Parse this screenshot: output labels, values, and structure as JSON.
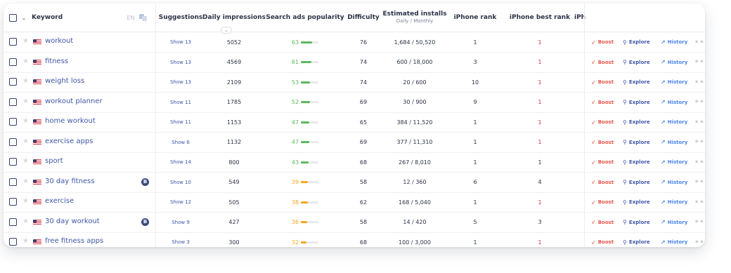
{
  "header": {
    "keyword": "Keyword",
    "lang": "EN",
    "suggestions": "Suggestions",
    "daily_impressions": "Daily impressions",
    "sort_icon": "⌄",
    "search_ads_popularity": "Search ads popularity",
    "difficulty": "Difficulty",
    "estimated_installs": "Estimated installs",
    "estimated_installs_sub": "Daily / Monthly",
    "iphone_rank": "iPhone rank",
    "iphone_best_rank": "iPhone best rank",
    "truncated_col": "iPh"
  },
  "actions": {
    "boost": "Boost",
    "explore": "Explore",
    "history": "History",
    "more": "•••"
  },
  "icons": {
    "boost": "rocket-icon",
    "explore": "search-icon",
    "history": "chart-icon",
    "flag": "us-flag-icon",
    "star": "star-icon",
    "translate": "translate-icon"
  },
  "colors": {
    "green": "#5cb85c",
    "orange": "#f5a623",
    "red": "#c4384a",
    "link": "#3f57a8"
  },
  "rows": [
    {
      "keyword": "workout",
      "badge": "",
      "suggestions": "Show 13",
      "impressions": "5052",
      "popularity": "63",
      "pop_color": "green",
      "difficulty": "76",
      "installs": "1,684 / 50,520",
      "rank": "1",
      "best_rank": "1",
      "best_red": true
    },
    {
      "keyword": "fitness",
      "badge": "",
      "suggestions": "Show 13",
      "impressions": "4569",
      "popularity": "61",
      "pop_color": "green",
      "difficulty": "74",
      "installs": "600 / 18,000",
      "rank": "3",
      "best_rank": "1",
      "best_red": true
    },
    {
      "keyword": "weight loss",
      "badge": "",
      "suggestions": "Show 13",
      "impressions": "2109",
      "popularity": "53",
      "pop_color": "green",
      "difficulty": "74",
      "installs": "20 / 600",
      "rank": "10",
      "best_rank": "1",
      "best_red": true
    },
    {
      "keyword": "workout planner",
      "badge": "",
      "suggestions": "Show 11",
      "impressions": "1785",
      "popularity": "52",
      "pop_color": "green",
      "difficulty": "69",
      "installs": "30 / 900",
      "rank": "9",
      "best_rank": "1",
      "best_red": true
    },
    {
      "keyword": "home workout",
      "badge": "",
      "suggestions": "Show 11",
      "impressions": "1153",
      "popularity": "47",
      "pop_color": "green",
      "difficulty": "65",
      "installs": "384 / 11,520",
      "rank": "1",
      "best_rank": "1",
      "best_red": true
    },
    {
      "keyword": "exercise apps",
      "badge": "",
      "suggestions": "Show 6",
      "impressions": "1132",
      "popularity": "47",
      "pop_color": "green",
      "difficulty": "69",
      "installs": "377 / 11,310",
      "rank": "1",
      "best_rank": "1",
      "best_red": true
    },
    {
      "keyword": "sport",
      "badge": "",
      "suggestions": "Show 14",
      "impressions": "800",
      "popularity": "43",
      "pop_color": "green",
      "difficulty": "68",
      "installs": "267 / 8,010",
      "rank": "1",
      "best_rank": "1",
      "best_red": false
    },
    {
      "keyword": "30 day fitness",
      "badge": "B",
      "suggestions": "Show 10",
      "impressions": "549",
      "popularity": "39",
      "pop_color": "orange",
      "difficulty": "58",
      "installs": "12 / 360",
      "rank": "6",
      "best_rank": "4",
      "best_red": false
    },
    {
      "keyword": "exercise",
      "badge": "",
      "suggestions": "Show 12",
      "impressions": "505",
      "popularity": "38",
      "pop_color": "orange",
      "difficulty": "62",
      "installs": "168 / 5,040",
      "rank": "1",
      "best_rank": "1",
      "best_red": true
    },
    {
      "keyword": "30 day workout",
      "badge": "B",
      "suggestions": "Show 9",
      "impressions": "427",
      "popularity": "36",
      "pop_color": "orange",
      "difficulty": "58",
      "installs": "14 / 420",
      "rank": "5",
      "best_rank": "3",
      "best_red": false
    },
    {
      "keyword": "free fitness apps",
      "badge": "",
      "suggestions": "Show 3",
      "impressions": "300",
      "popularity": "32",
      "pop_color": "orange",
      "difficulty": "68",
      "installs": "100 / 3,000",
      "rank": "1",
      "best_rank": "1",
      "best_red": true
    }
  ]
}
